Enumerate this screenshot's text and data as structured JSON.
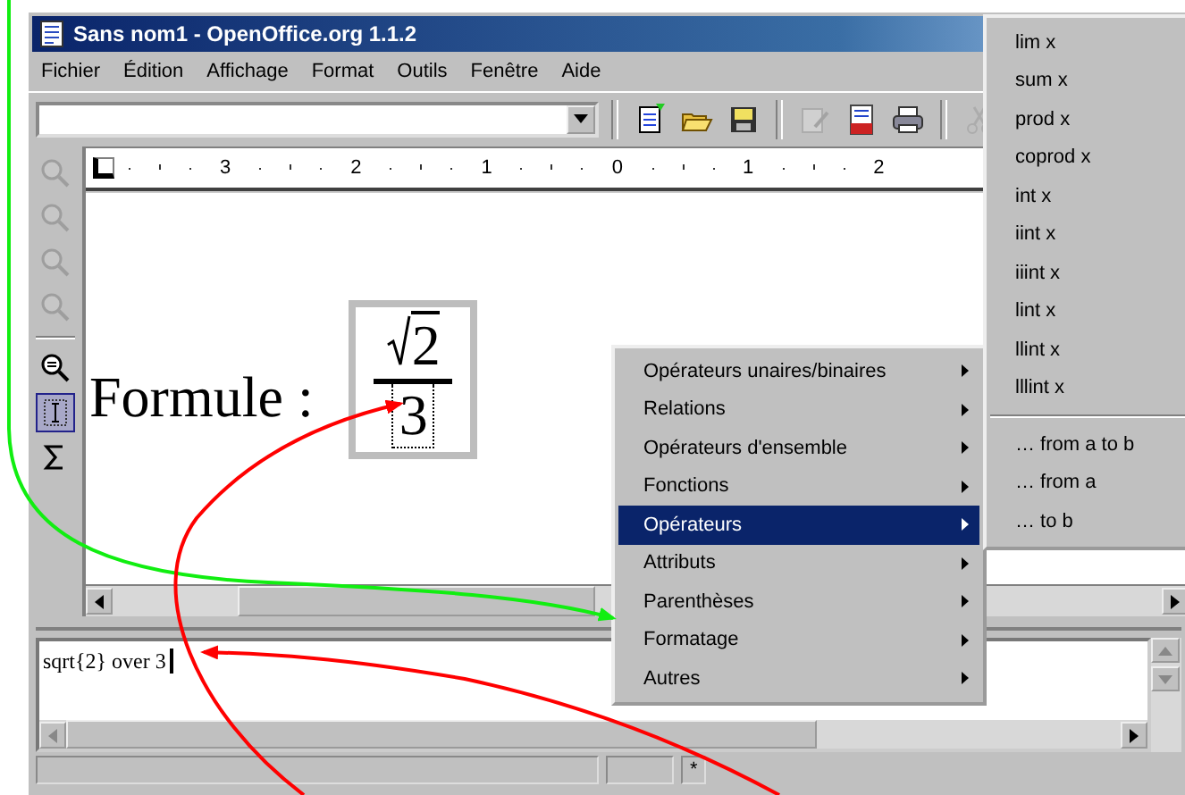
{
  "window": {
    "title": "Sans nom1 - OpenOffice.org 1.1.2"
  },
  "menu_bar": [
    "Fichier",
    "Édition",
    "Affichage",
    "Format",
    "Outils",
    "Fenêtre",
    "Aide"
  ],
  "toolbar": [
    {
      "kind": "new",
      "disabled": false
    },
    {
      "kind": "open",
      "disabled": false
    },
    {
      "kind": "save",
      "disabled": false
    },
    {
      "kind": "edit",
      "disabled": true
    },
    {
      "kind": "pdf",
      "disabled": false
    },
    {
      "kind": "print",
      "disabled": false
    },
    {
      "kind": "cut",
      "disabled": true
    }
  ],
  "side_tools": [
    {
      "kind": "zoom",
      "disabled": true,
      "selected": false
    },
    {
      "kind": "zoom",
      "disabled": true,
      "selected": false
    },
    {
      "kind": "zoom",
      "disabled": true,
      "selected": false
    },
    {
      "kind": "zoom",
      "disabled": true,
      "selected": false
    },
    {
      "kind": "zoom-fit",
      "disabled": false,
      "selected": false
    },
    {
      "kind": "cursor",
      "disabled": false,
      "selected": true
    },
    {
      "kind": "sigma",
      "disabled": false,
      "selected": false
    }
  ],
  "ruler": [
    "3",
    "2",
    "1",
    "0",
    "1",
    "2"
  ],
  "document": {
    "text": "Formule :",
    "formula": {
      "numerator": "2",
      "denominator": "3"
    }
  },
  "command": {
    "value": "sqrt{2} over 3"
  },
  "status_bar": {
    "field_3": "*"
  },
  "context_menu": [
    {
      "label": "Opérateurs unaires/binaires",
      "selected": false
    },
    {
      "label": "Relations",
      "selected": false
    },
    {
      "label": "Opérateurs d'ensemble",
      "selected": false
    },
    {
      "label": "Fonctions",
      "selected": false
    },
    {
      "label": "Opérateurs",
      "selected": true
    },
    {
      "label": "Attributs",
      "selected": false
    },
    {
      "label": "Parenthèses",
      "selected": false
    },
    {
      "label": "Formatage",
      "selected": false
    },
    {
      "label": "Autres",
      "selected": false
    }
  ],
  "submenu": {
    "items": [
      "lim x",
      "sum x",
      "prod x",
      "coprod x",
      "int x",
      "iint x",
      "iiint x",
      "lint x",
      "llint x",
      "lllint x"
    ],
    "range_items": [
      "… from a to b",
      "… from a",
      "… to b"
    ]
  }
}
